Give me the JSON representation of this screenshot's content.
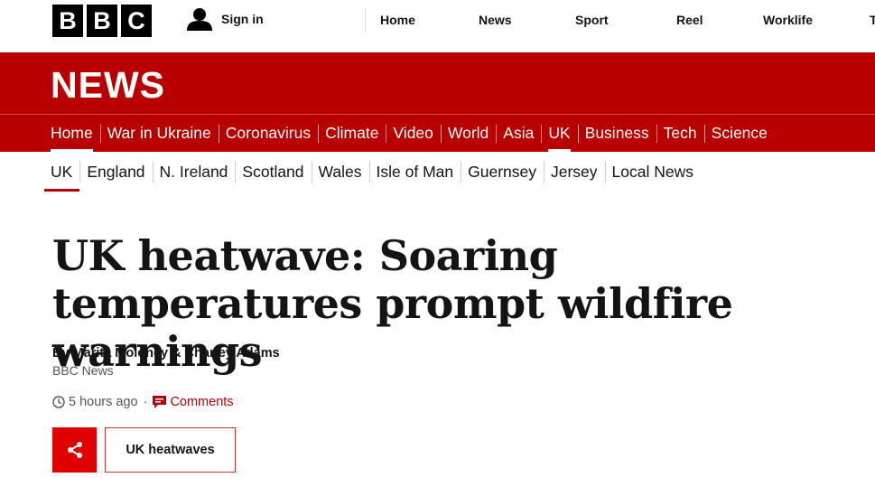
{
  "brand": {
    "letters": [
      "B",
      "B",
      "C"
    ]
  },
  "account": {
    "signin_label": "Sign in",
    "icon": "user-icon"
  },
  "top_nav": [
    {
      "label": "Home"
    },
    {
      "label": "News"
    },
    {
      "label": "Sport"
    },
    {
      "label": "Reel"
    },
    {
      "label": "Worklife"
    },
    {
      "label": "T"
    }
  ],
  "section": {
    "title": "NEWS"
  },
  "primary_nav": [
    {
      "label": "Home"
    },
    {
      "label": "War in Ukraine"
    },
    {
      "label": "Coronavirus"
    },
    {
      "label": "Climate"
    },
    {
      "label": "Video"
    },
    {
      "label": "World"
    },
    {
      "label": "Asia"
    },
    {
      "label": "UK"
    },
    {
      "label": "Business"
    },
    {
      "label": "Tech"
    },
    {
      "label": "Science"
    }
  ],
  "secondary_nav": [
    {
      "label": "UK"
    },
    {
      "label": "England"
    },
    {
      "label": "N. Ireland"
    },
    {
      "label": "Scotland"
    },
    {
      "label": "Wales"
    },
    {
      "label": "Isle of Man"
    },
    {
      "label": "Guernsey"
    },
    {
      "label": "Jersey"
    },
    {
      "label": "Local News"
    }
  ],
  "article": {
    "headline": "UK heatwave: Soaring temperatures prompt wildfire warnings",
    "byline": "By Marita Moloney & Charley Adams",
    "source": "BBC News",
    "timestamp": "5 hours ago",
    "separator": "·",
    "comments_label": "Comments",
    "topic_tag": "UK heatwaves",
    "share_icon": "share-icon",
    "clock_icon": "clock-icon",
    "comment_icon": "comment-icon"
  },
  "colors": {
    "brand_red": "#b80000",
    "share_red": "#e00000",
    "text": "#141414",
    "muted": "#545658"
  }
}
